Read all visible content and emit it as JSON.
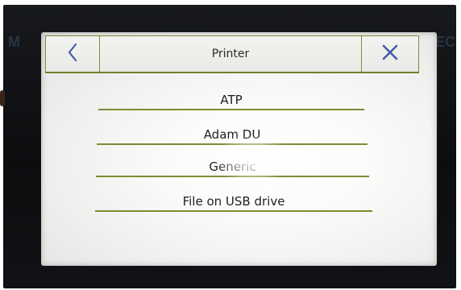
{
  "header": {
    "title": "Printer",
    "back_icon": "chevron-left-icon",
    "close_icon": "close-icon"
  },
  "menu": {
    "items": [
      {
        "label": "ATP"
      },
      {
        "label": "Adam DU"
      },
      {
        "label": "Generic"
      },
      {
        "label": "File on USB drive"
      }
    ]
  },
  "colors": {
    "accent_line": "#7b8d33",
    "icon_blue": "#3f5fa8",
    "bezel": "#111215",
    "screen": "#f2f2f0"
  }
}
